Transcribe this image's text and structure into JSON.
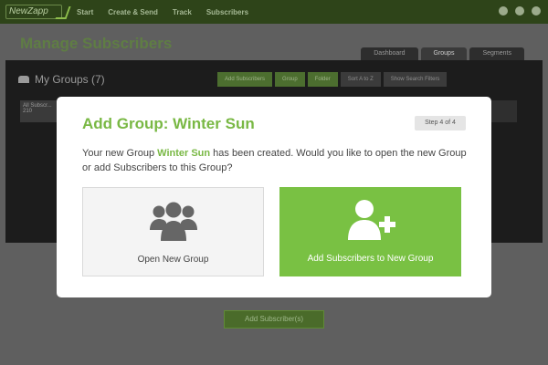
{
  "app": {
    "logo": "NewZapp",
    "nav": [
      "Start",
      "Create & Send",
      "Track",
      "Subscribers"
    ]
  },
  "page": {
    "title": "Manage Subscribers",
    "tabs": [
      "Dashboard",
      "Groups",
      "Segments"
    ],
    "active_tab": "Groups",
    "groups_title": "My Groups (7)",
    "toolbar": [
      "Add Subscribers",
      "Group",
      "Folder",
      "Sort A to Z",
      "Show Search Filters"
    ],
    "group_card": {
      "name": "All Subscr...",
      "count": "210"
    },
    "add_button": "Add Subscriber(s)"
  },
  "modal": {
    "title": "Add Group: Winter Sun",
    "step": "Step 4 of 4",
    "message_pre": "Your new Group ",
    "group_name": "Winter Sun",
    "message_post": " has been created. Would you like to open the new Group or add Subscribers to this Group?",
    "options": {
      "open_group": "Open New Group",
      "add_subscribers": "Add Subscribers to New Group"
    }
  },
  "colors": {
    "accent": "#79b844",
    "action_bg": "#79c143",
    "nav_bg": "#2e4419"
  }
}
